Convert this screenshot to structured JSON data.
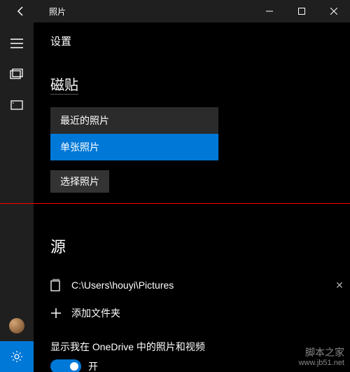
{
  "titlebar": {
    "app_name": "照片"
  },
  "page": {
    "title": "设置"
  },
  "tile": {
    "heading": "磁贴",
    "options": [
      "最近的照片",
      "单张照片"
    ],
    "selected_index": 1,
    "choose_button": "选择照片"
  },
  "sources": {
    "heading": "源",
    "items": [
      {
        "path": "C:\\Users\\houyi\\Pictures"
      }
    ],
    "add_label": "添加文件夹"
  },
  "onedrive": {
    "label": "显示我在 OneDrive 中的照片和视频",
    "state": "开",
    "on": true
  },
  "watermark": {
    "site": "脚本之家",
    "url": "www.jb51.net"
  }
}
